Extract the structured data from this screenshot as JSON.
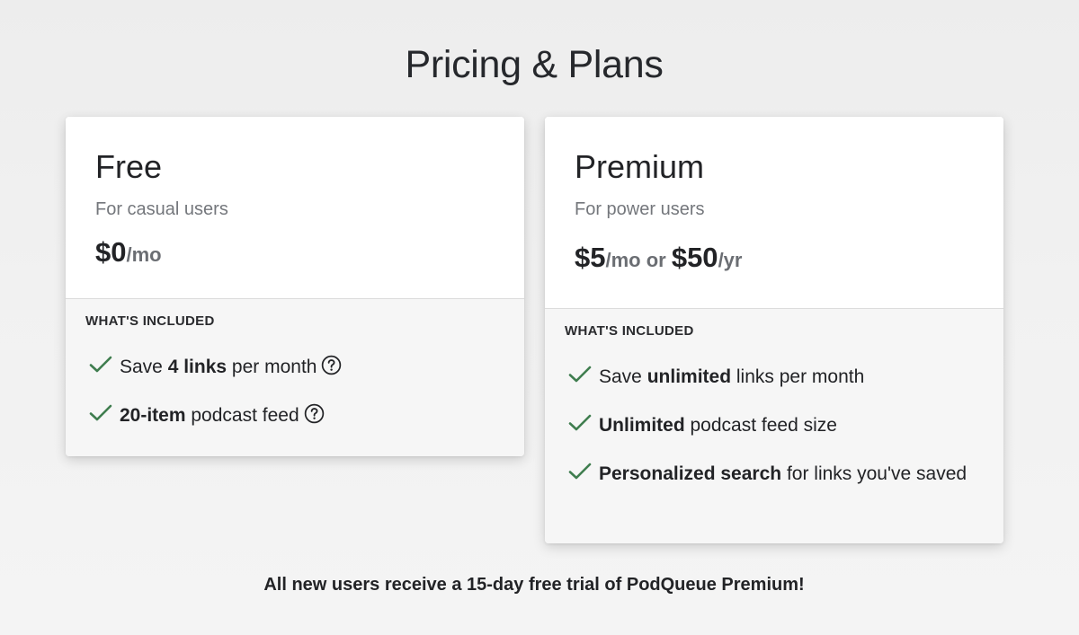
{
  "title": "Pricing & Plans",
  "plans": [
    {
      "name": "Free",
      "description": "For casual users",
      "price": {
        "amount": "$0",
        "unit": "/mo"
      },
      "included_label": "WHAT'S INCLUDED",
      "features": [
        {
          "pre": "Save ",
          "bold": "4 links",
          "post": " per month",
          "help": true
        },
        {
          "pre": "",
          "bold": "20-item",
          "post": " podcast feed",
          "help": true
        }
      ]
    },
    {
      "name": "Premium",
      "description": "For power users",
      "price": {
        "amount": "$5",
        "unit": "/mo or ",
        "amount2": "$50",
        "unit2": "/yr"
      },
      "included_label": "WHAT'S INCLUDED",
      "features": [
        {
          "pre": "Save ",
          "bold": "unlimited",
          "post": " links per month",
          "help": false
        },
        {
          "pre": "",
          "bold": "Unlimited",
          "post": " podcast feed size",
          "help": false
        },
        {
          "pre": "",
          "bold": "Personalized search",
          "post": " for links you've saved",
          "help": false
        }
      ]
    }
  ],
  "footer_note": "All new users receive a 15-day free trial of PodQueue Premium!",
  "colors": {
    "check": "#3f7d4f",
    "muted_text": "#74777c",
    "card_body_bg": "#f6f6f6"
  },
  "icons": {
    "check": "check-icon",
    "help": "help-circle-icon"
  }
}
